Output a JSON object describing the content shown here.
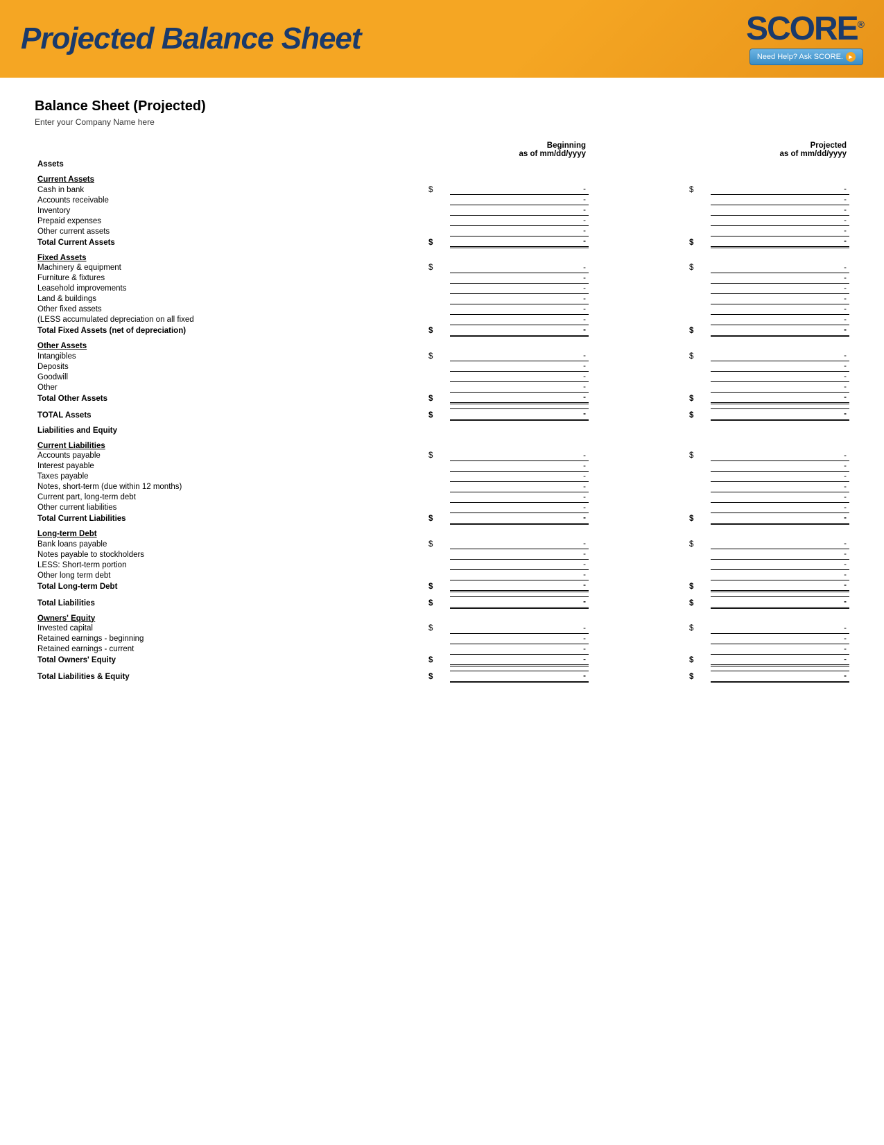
{
  "header": {
    "title": "Projected Balance Sheet",
    "score_logo": "SCORE",
    "score_registered": "®",
    "need_help": "Need Help? Ask SCORE."
  },
  "document": {
    "title": "Balance Sheet (Projected)",
    "company_name": "Enter your Company Name here",
    "col_beginning_label": "Beginning",
    "col_beginning_sub": "as of mm/dd/yyyy",
    "col_projected_label": "Projected",
    "col_projected_sub": "as of mm/dd/yyyy"
  },
  "assets_label": "Assets",
  "sections": {
    "current_assets": {
      "header": "Current Assets",
      "items": [
        {
          "label": "Cash in bank",
          "show_dollar": true,
          "begin": "-",
          "proj": "-"
        },
        {
          "label": "Accounts receivable",
          "show_dollar": false,
          "begin": "-",
          "proj": "-"
        },
        {
          "label": "Inventory",
          "show_dollar": false,
          "begin": "-",
          "proj": "-"
        },
        {
          "label": "Prepaid expenses",
          "show_dollar": false,
          "begin": "-",
          "proj": "-"
        },
        {
          "label": "Other current assets",
          "show_dollar": false,
          "begin": "-",
          "proj": "-"
        }
      ],
      "total_label": "Total Current Assets",
      "total_begin": "-",
      "total_proj": "-"
    },
    "fixed_assets": {
      "header": "Fixed Assets",
      "items": [
        {
          "label": "Machinery & equipment",
          "show_dollar": true,
          "begin": "-",
          "proj": "-"
        },
        {
          "label": "Furniture & fixtures",
          "show_dollar": false,
          "begin": "-",
          "proj": "-"
        },
        {
          "label": "Leasehold improvements",
          "show_dollar": false,
          "begin": "-",
          "proj": "-"
        },
        {
          "label": "Land & buildings",
          "show_dollar": false,
          "begin": "-",
          "proj": "-"
        },
        {
          "label": "Other fixed assets",
          "show_dollar": false,
          "begin": "-",
          "proj": "-"
        },
        {
          "label": "(LESS accumulated depreciation on all fixed",
          "show_dollar": false,
          "begin": "-",
          "proj": "-"
        }
      ],
      "total_label": "Total Fixed Assets (net of depreciation)",
      "total_begin": "-",
      "total_proj": "-"
    },
    "other_assets": {
      "header": "Other Assets",
      "items": [
        {
          "label": "Intangibles",
          "show_dollar": true,
          "begin": "-",
          "proj": "-"
        },
        {
          "label": "Deposits",
          "show_dollar": false,
          "begin": "-",
          "proj": "-"
        },
        {
          "label": "Goodwill",
          "show_dollar": false,
          "begin": "-",
          "proj": "-"
        },
        {
          "label": "Other",
          "show_dollar": false,
          "begin": "-",
          "proj": "-"
        }
      ],
      "total_label": "Total Other Assets",
      "total_begin": "-",
      "total_proj": "-"
    },
    "total_assets": {
      "label": "TOTAL Assets",
      "begin": "-",
      "proj": "-"
    },
    "liabilities_equity_header": "Liabilities and Equity",
    "current_liabilities": {
      "header": "Current Liabilities",
      "items": [
        {
          "label": "Accounts payable",
          "show_dollar": true,
          "begin": "-",
          "proj": "-"
        },
        {
          "label": "Interest payable",
          "show_dollar": false,
          "begin": "-",
          "proj": "-"
        },
        {
          "label": "Taxes payable",
          "show_dollar": false,
          "begin": "-",
          "proj": "-"
        },
        {
          "label": "Notes, short-term (due within 12 months)",
          "show_dollar": false,
          "begin": "-",
          "proj": "-"
        },
        {
          "label": "Current part, long-term debt",
          "show_dollar": false,
          "begin": "-",
          "proj": "-"
        },
        {
          "label": "Other current liabilities",
          "show_dollar": false,
          "begin": "-",
          "proj": "-"
        }
      ],
      "total_label": "Total Current Liabilities",
      "total_begin": "-",
      "total_proj": "-"
    },
    "long_term_debt": {
      "header": "Long-term Debt",
      "items": [
        {
          "label": "Bank loans payable",
          "show_dollar": true,
          "begin": "-",
          "proj": "-"
        },
        {
          "label": "Notes payable to stockholders",
          "show_dollar": false,
          "begin": "-",
          "proj": "-"
        },
        {
          "label": "LESS: Short-term portion",
          "show_dollar": false,
          "begin": "-",
          "proj": "-"
        },
        {
          "label": "Other long term debt",
          "show_dollar": false,
          "begin": "-",
          "proj": "-"
        }
      ],
      "total_label": "Total Long-term Debt",
      "total_begin": "-",
      "total_proj": "-"
    },
    "total_liabilities": {
      "label": "Total Liabilities",
      "begin": "-",
      "proj": "-"
    },
    "owners_equity": {
      "header": "Owners' Equity",
      "items": [
        {
          "label": "Invested capital",
          "show_dollar": true,
          "begin": "-",
          "proj": "-"
        },
        {
          "label": "Retained earnings - beginning",
          "show_dollar": false,
          "begin": "-",
          "proj": "-"
        },
        {
          "label": "Retained earnings - current",
          "show_dollar": false,
          "begin": "-",
          "proj": "-"
        }
      ],
      "total_label": "Total Owners' Equity",
      "total_begin": "-",
      "total_proj": "-"
    },
    "total_liabilities_equity": {
      "label": "Total Liabilities & Equity",
      "begin": "-",
      "proj": "-"
    }
  }
}
